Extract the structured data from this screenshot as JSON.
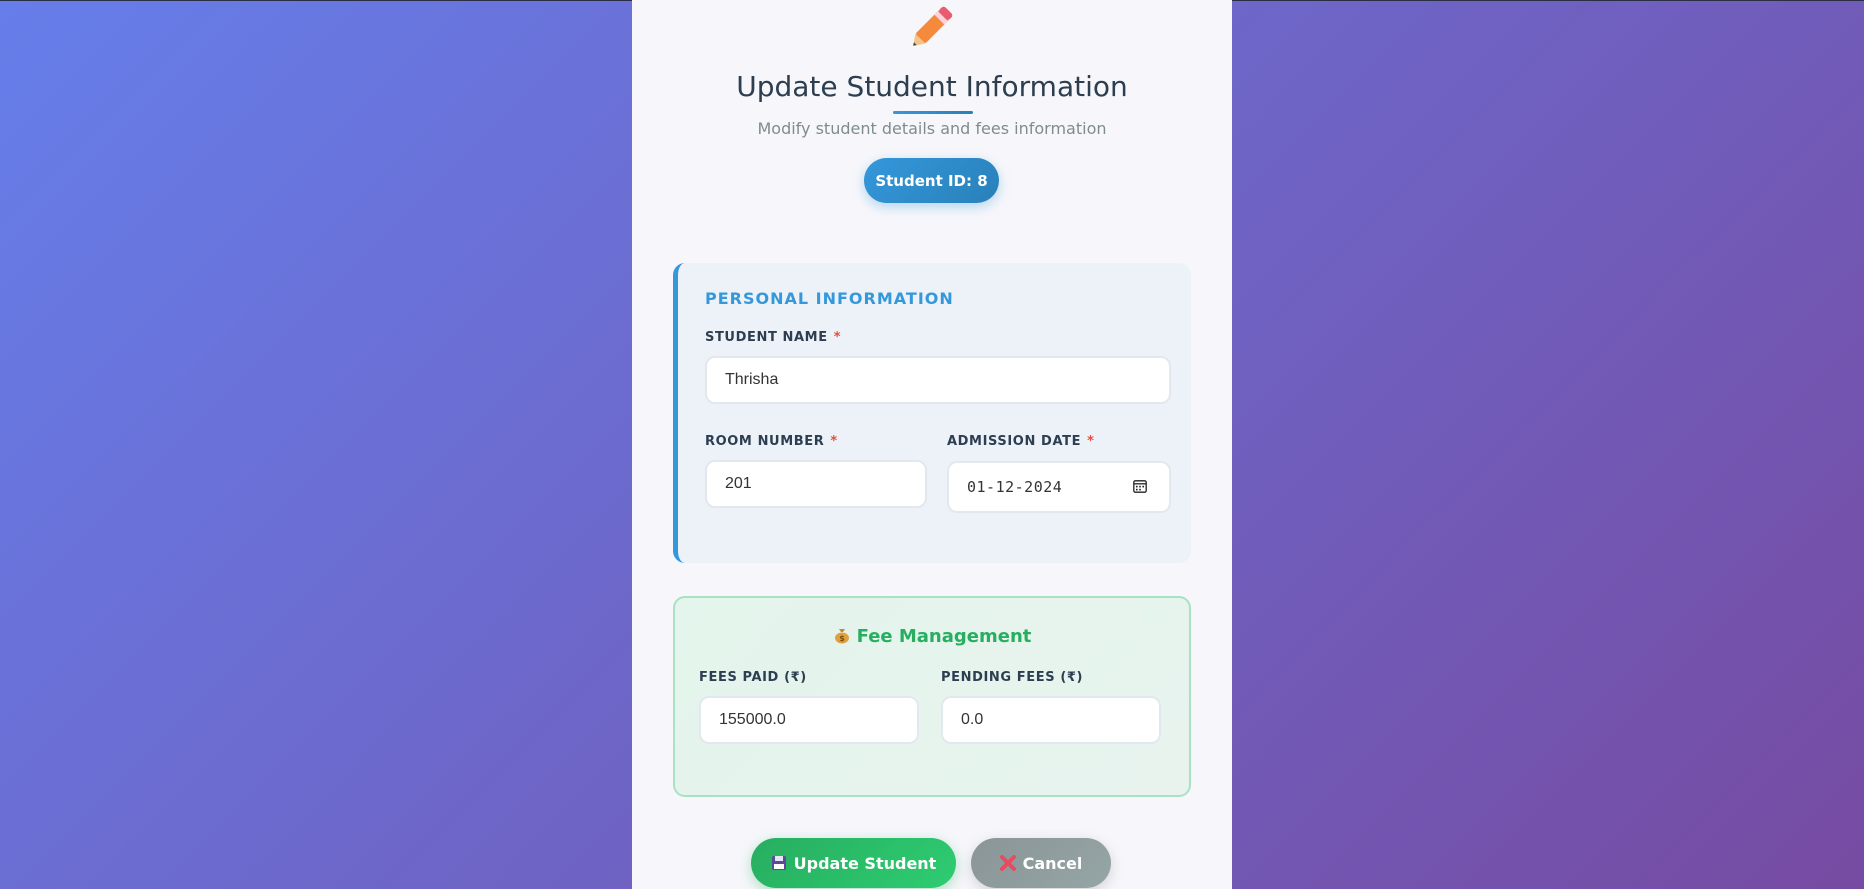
{
  "header": {
    "icon": "pencil-icon",
    "title": "Update Student Information",
    "subtitle": "Modify student details and fees information",
    "student_id_label": "Student ID: 8"
  },
  "personal_section": {
    "title": "PERSONAL INFORMATION",
    "student_name_label": "STUDENT NAME",
    "student_name_value": "Thrisha",
    "room_number_label": "ROOM NUMBER",
    "room_number_value": "201",
    "admission_date_label": "ADMISSION DATE",
    "admission_date_value": "01-12-2024",
    "required_mark": "*"
  },
  "fee_section": {
    "icon": "money-bag-icon",
    "title": "Fee Management",
    "fees_paid_label": "FEES PAID (₹)",
    "fees_paid_value": "155000.0",
    "pending_fees_label": "PENDING FEES (₹)",
    "pending_fees_value": "0.0"
  },
  "actions": {
    "update_label": "Update Student",
    "update_icon": "floppy-disk-icon",
    "cancel_label": "Cancel",
    "cancel_icon": "cross-mark-icon"
  },
  "colors": {
    "accent_blue": "#3498db",
    "success_green": "#27ae60",
    "required_red": "#e74c3c",
    "cancel_gray": "#95a5a6"
  }
}
